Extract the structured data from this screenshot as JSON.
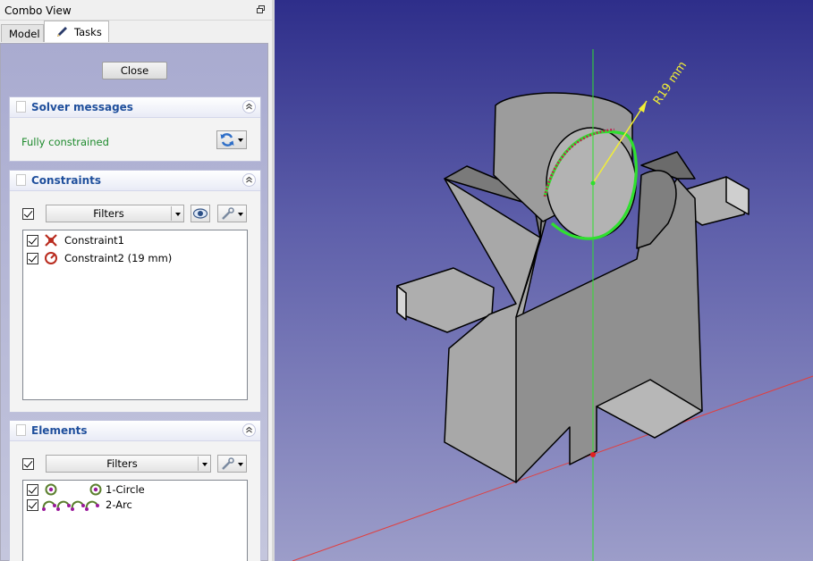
{
  "window": {
    "title": "Combo View"
  },
  "tabs": [
    {
      "label": "Model"
    },
    {
      "label": "Tasks"
    }
  ],
  "task_panel": {
    "close_label": "Close",
    "solver": {
      "title": "Solver messages",
      "status": "Fully constrained"
    },
    "constraints": {
      "title": "Constraints",
      "filter_label": "Filters",
      "items": [
        {
          "label": "Constraint1",
          "icon": "coincident-constraint-icon",
          "checked": true
        },
        {
          "label": "Constraint2 (19 mm)",
          "icon": "radius-constraint-icon",
          "checked": true
        }
      ]
    },
    "elements": {
      "title": "Elements",
      "filter_label": "Filters",
      "items": [
        {
          "label": "1-Circle",
          "icon": "circle-element-icon",
          "checked": true
        },
        {
          "label": "2-Arc",
          "icon": "arc-element-icon",
          "checked": true
        }
      ]
    }
  },
  "viewport": {
    "dimension_label": "R19 mm"
  },
  "colors": {
    "status_green": "#1d8a2c",
    "panel_title_blue": "#1f4f9c",
    "selection_green": "#2fe02f",
    "dimension_yellow": "#f2ef35",
    "axis_red": "#e04040"
  }
}
